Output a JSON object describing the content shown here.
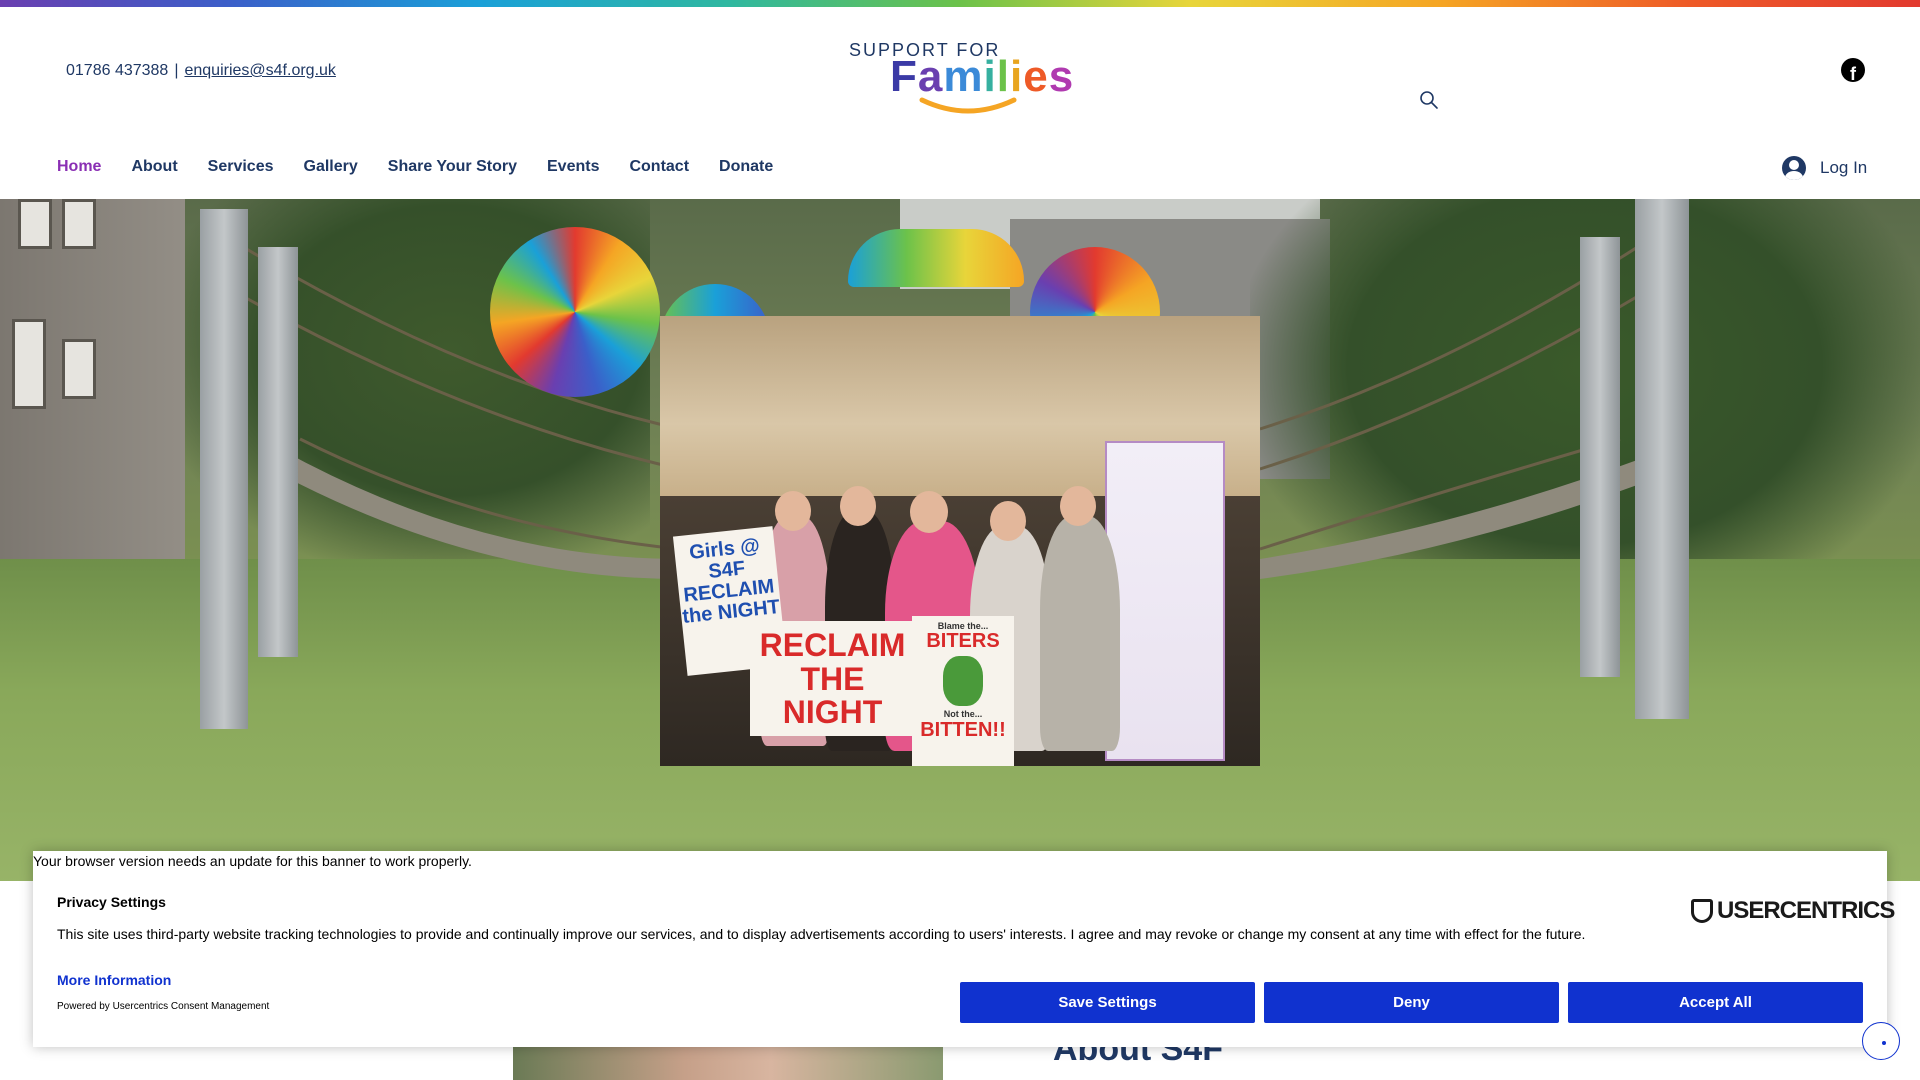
{
  "header": {
    "phone": "01786 437388",
    "separator": "|",
    "email": "enquiries@s4f.org.uk",
    "logo_top": "SUPPORT FOR",
    "logo_main": "Families"
  },
  "nav": {
    "items": [
      {
        "label": "Home",
        "active": true
      },
      {
        "label": "About"
      },
      {
        "label": "Services"
      },
      {
        "label": "Gallery"
      },
      {
        "label": "Share Your Story"
      },
      {
        "label": "Events"
      },
      {
        "label": "Contact"
      },
      {
        "label": "Donate"
      }
    ],
    "login_label": "Log In"
  },
  "icons": [
    "facebook-icon",
    "search-icon",
    "user-avatar-icon"
  ],
  "hero": {
    "sign1": "Girls @ S4F RECLAIM the NIGHT",
    "sign2": "RECLAIM THE NIGHT",
    "sign3_top": "Blame the...",
    "sign3_main": "BITERS",
    "sign3_sub": "Not the...",
    "sign3_bottom": "BITTEN!!"
  },
  "cookie_banner": {
    "warning": "Your browser version needs an update for this banner to work properly.",
    "title": "Privacy Settings",
    "text": "This site uses third-party website tracking technologies to provide and continually improve our services, and to display advertisements according to users' interests. I agree and may revoke or change my consent at any time with effect for the future.",
    "more_info": "More Information",
    "powered_by": "Powered by Usercentrics Consent Management",
    "brand": "USERCENTRICS",
    "buttons": {
      "save": "Save Settings",
      "deny": "Deny",
      "accept": "Accept All"
    }
  },
  "content": {
    "about_heading": "About S4F"
  },
  "colors": {
    "navy": "#1f3864",
    "active_nav": "#8a2fb4",
    "consent_blue": "#1032cf"
  }
}
